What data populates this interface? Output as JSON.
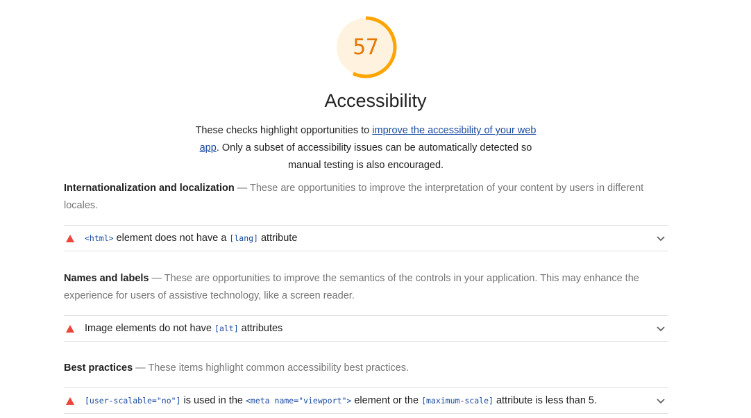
{
  "gauge": {
    "score": "57",
    "fraction": 0.57,
    "color": "#ffa400",
    "fill": "#fff3e0",
    "text_color": "#e67700"
  },
  "category": {
    "title": "Accessibility",
    "description_pre": "These checks highlight opportunities to ",
    "description_link": "improve the accessibility of your web app",
    "description_post": ". Only a subset of accessibility issues can be automatically detected so manual testing is also encouraged."
  },
  "groups": [
    {
      "title": "Internationalization and localization",
      "description": "These are opportunities to improve the interpretation of your content by users in different locales.",
      "audits": [
        {
          "parts": [
            {
              "code": "<html>"
            },
            {
              "text": " element does not have a "
            },
            {
              "code": "[lang]"
            },
            {
              "text": " attribute"
            }
          ]
        }
      ]
    },
    {
      "title": "Names and labels",
      "description": "These are opportunities to improve the semantics of the controls in your application. This may enhance the experience for users of assistive technology, like a screen reader.",
      "audits": [
        {
          "parts": [
            {
              "text": "Image elements do not have "
            },
            {
              "code": "[alt]"
            },
            {
              "text": " attributes"
            }
          ]
        }
      ]
    },
    {
      "title": "Best practices",
      "description": "These items highlight common accessibility best practices.",
      "audits": [
        {
          "parts": [
            {
              "code": "[user-scalable=\"no\"]"
            },
            {
              "text": " is used in the "
            },
            {
              "code": "<meta name=\"viewport\">"
            },
            {
              "text": " element or the "
            },
            {
              "code": "[maximum-scale]"
            },
            {
              "text": " attribute is less than 5."
            }
          ]
        }
      ]
    }
  ],
  "separator": " — ",
  "colors": {
    "fail": "#eb0f00",
    "link": "#1a4ba0",
    "divider": "#e0e0e0"
  }
}
